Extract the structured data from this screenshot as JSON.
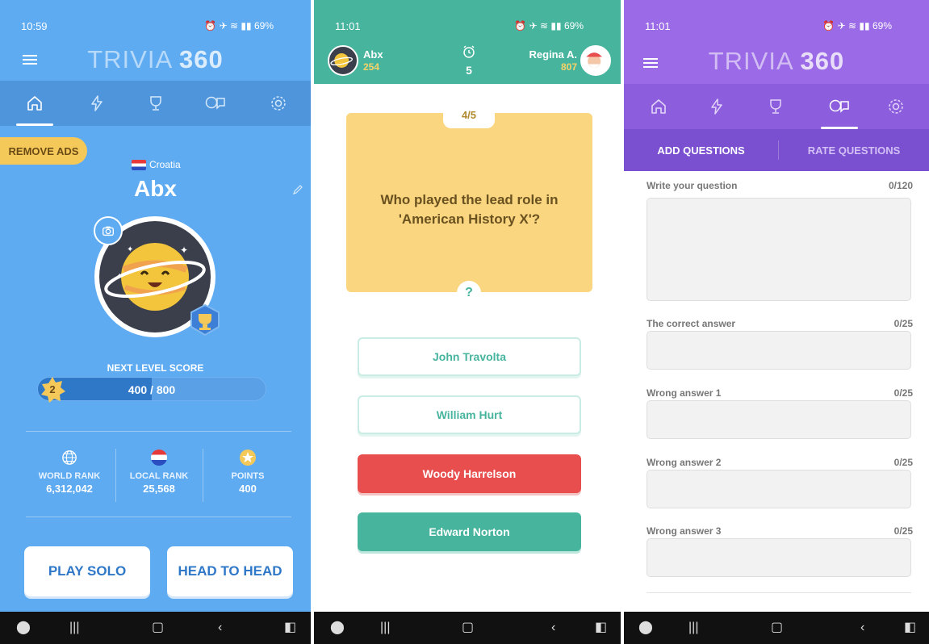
{
  "panel1": {
    "status": {
      "time": "10:59",
      "battery": "69%"
    },
    "app_logo": {
      "light": "TRIVIA",
      "bold": "360"
    },
    "remove_ads": "REMOVE ADS",
    "country": "Croatia",
    "username": "Abx",
    "next_level_label": "NEXT LEVEL SCORE",
    "level": "2",
    "progress": {
      "current": 400,
      "target": 800,
      "text": "400 / 800"
    },
    "stats": [
      {
        "label": "WORLD RANK",
        "value": "6,312,042",
        "icon": "globe-icon"
      },
      {
        "label": "LOCAL RANK",
        "value": "25,568",
        "icon": "croatia-flag-icon"
      },
      {
        "label": "POINTS",
        "value": "400",
        "icon": "star-coin-icon"
      }
    ],
    "buttons": {
      "play_solo": "PLAY SOLO",
      "head_to_head": "HEAD TO HEAD"
    },
    "colors": {
      "bg": "#5eabf2",
      "tabbar": "#4f95dc",
      "accent": "#f5c85a"
    }
  },
  "panel2": {
    "status": {
      "time": "11:01",
      "battery": "69%"
    },
    "player1": {
      "name": "Abx",
      "score": "254"
    },
    "player2": {
      "name": "Regina A.",
      "score": "807"
    },
    "timer": "5",
    "question_index": "4/5",
    "question": "Who played the lead role in 'American History X'?",
    "qmark": "?",
    "answers": [
      {
        "text": "John Travolta",
        "state": "neutral"
      },
      {
        "text": "William Hurt",
        "state": "neutral"
      },
      {
        "text": "Woody Harrelson",
        "state": "wrong"
      },
      {
        "text": "Edward Norton",
        "state": "correct"
      }
    ],
    "colors": {
      "header": "#47b49e",
      "card": "#fad680",
      "wrong": "#e84e4e",
      "correct": "#47b49e"
    }
  },
  "panel3": {
    "status": {
      "time": "11:01",
      "battery": "69%"
    },
    "app_logo": {
      "light": "TRIVIA",
      "bold": "360"
    },
    "subtabs": {
      "add": "ADD QUESTIONS",
      "rate": "RATE QUESTIONS"
    },
    "fields": [
      {
        "label": "Write your question",
        "count": "0/120"
      },
      {
        "label": "The correct answer",
        "count": "0/25"
      },
      {
        "label": "Wrong answer 1",
        "count": "0/25"
      },
      {
        "label": "Wrong answer 2",
        "count": "0/25"
      },
      {
        "label": "Wrong answer 3",
        "count": "0/25"
      }
    ],
    "colors": {
      "header": "#9b6ae6",
      "tabbar": "#8c5ddc",
      "subtabs": "#7a4fd0"
    }
  }
}
